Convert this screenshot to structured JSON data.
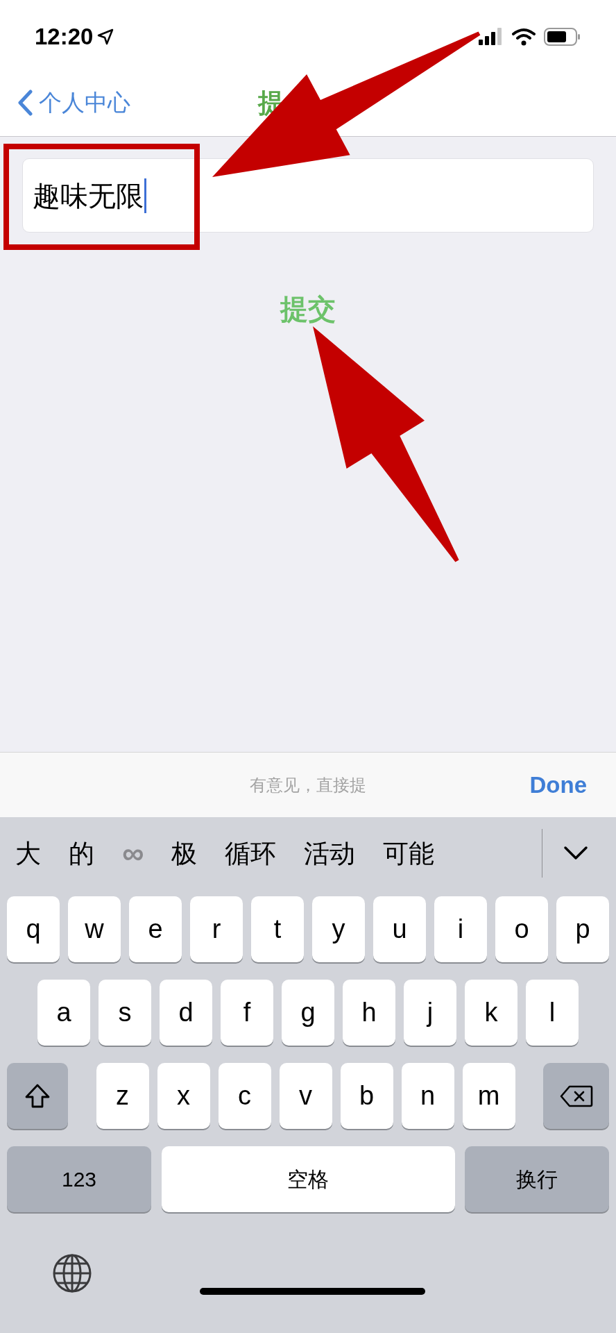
{
  "status_bar": {
    "time": "12:20"
  },
  "nav": {
    "back_label": "个人中心",
    "title": "提"
  },
  "field": {
    "value": "趣味无限"
  },
  "submit_button": {
    "label": "提交"
  },
  "toolbar": {
    "hint": "有意见，直接提",
    "done": "Done"
  },
  "candidates": [
    {
      "kind": "text",
      "label": "大"
    },
    {
      "kind": "text",
      "label": "的"
    },
    {
      "kind": "symbol",
      "label": "∞"
    },
    {
      "kind": "text",
      "label": "极"
    },
    {
      "kind": "text",
      "label": "循环"
    },
    {
      "kind": "text",
      "label": "活动"
    },
    {
      "kind": "text",
      "label": "可能"
    }
  ],
  "keyboard": {
    "rows": [
      [
        "q",
        "w",
        "e",
        "r",
        "t",
        "y",
        "u",
        "i",
        "o",
        "p"
      ],
      [
        "a",
        "s",
        "d",
        "f",
        "g",
        "h",
        "j",
        "k",
        "l"
      ],
      [
        "z",
        "x",
        "c",
        "v",
        "b",
        "n",
        "m"
      ]
    ],
    "numbers_key": "123",
    "space_key": "空格",
    "return_key": "换行"
  }
}
